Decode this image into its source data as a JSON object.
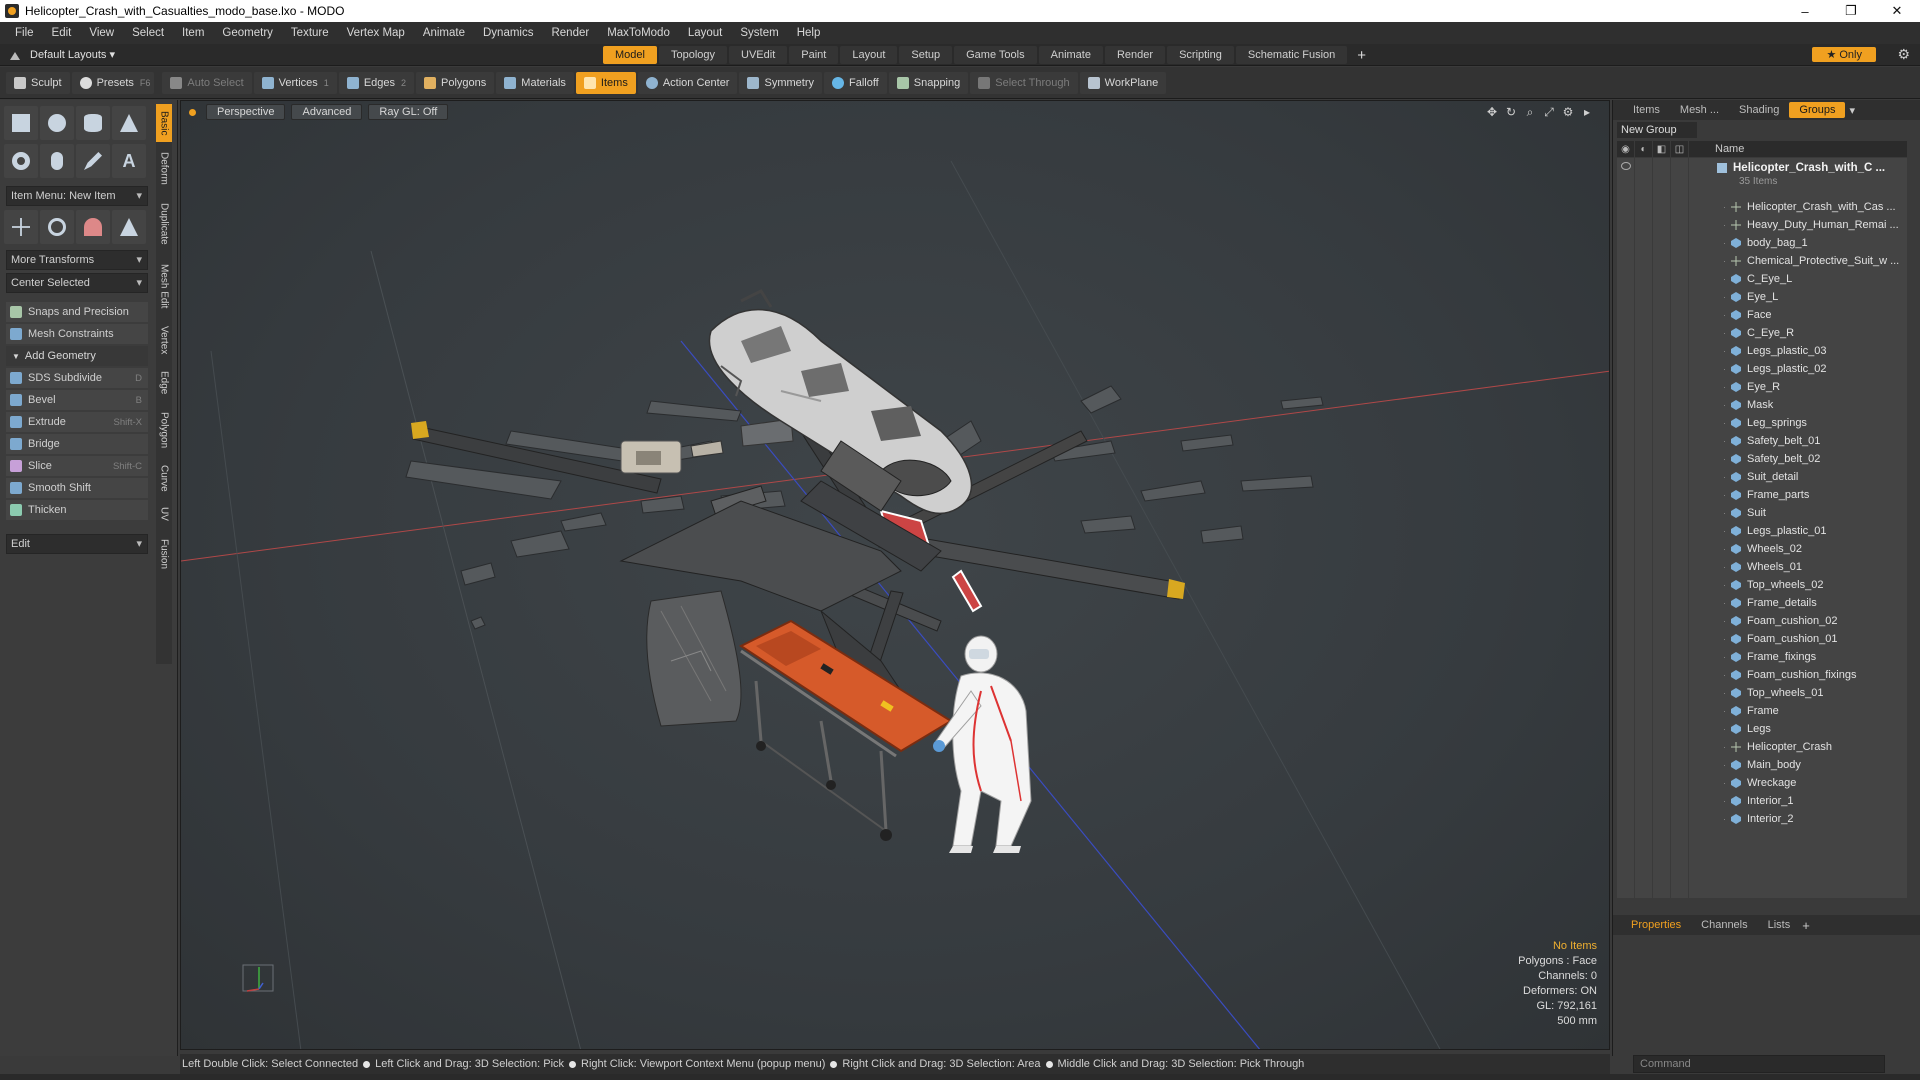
{
  "window": {
    "title": "Helicopter_Crash_with_Casualties_modo_base.lxo - MODO",
    "controls": [
      "–",
      "❐",
      "✕"
    ]
  },
  "menu": [
    "File",
    "Edit",
    "View",
    "Select",
    "Item",
    "Geometry",
    "Texture",
    "Vertex Map",
    "Animate",
    "Dynamics",
    "Render",
    "MaxToModo",
    "Layout",
    "System",
    "Help"
  ],
  "layoutbar": {
    "layout_dropdown": "Default Layouts ▾",
    "tabs": [
      "Model",
      "Topology",
      "UVEdit",
      "Paint",
      "Layout",
      "Setup",
      "Game Tools",
      "Animate",
      "Render",
      "Scripting",
      "Schematic Fusion"
    ],
    "active_tab": "Model",
    "add": "+",
    "only": "★ Only"
  },
  "toolbar": {
    "sculpt": "Sculpt",
    "presets": "Presets",
    "presets_key": "F6",
    "auto_select": "Auto Select",
    "vertices": "Vertices",
    "vertices_key": "1",
    "edges": "Edges",
    "edges_key": "2",
    "polygons": "Polygons",
    "materials": "Materials",
    "items": "Items",
    "action_center": "Action Center",
    "symmetry": "Symmetry",
    "falloff": "Falloff",
    "snapping": "Snapping",
    "select_through": "Select Through",
    "workplane": "WorkPlane"
  },
  "leftpanel": {
    "item_menu": "Item Menu: New Item",
    "more_transforms": "More Transforms",
    "center_selected": "Center Selected",
    "snaps": "Snaps and Precision",
    "mesh_constraints": "Mesh Constraints",
    "add_geometry": "Add Geometry",
    "tools": [
      {
        "label": "SDS Subdivide",
        "key": "D"
      },
      {
        "label": "Bevel",
        "key": "B"
      },
      {
        "label": "Extrude",
        "key": "Shift-X"
      },
      {
        "label": "Bridge",
        "key": ""
      },
      {
        "label": "Slice",
        "key": "Shift-C"
      },
      {
        "label": "Smooth Shift",
        "key": ""
      },
      {
        "label": "Thicken",
        "key": ""
      }
    ],
    "edit_dropdown": "Edit",
    "vtabs": [
      "Basic",
      "Deform",
      "Duplicate",
      "Mesh Edit",
      "Vertex",
      "Edge",
      "Polygon",
      "Curve",
      "UV",
      "Fusion"
    ]
  },
  "viewport": {
    "view": "Perspective",
    "shading": "Advanced",
    "raygl": "Ray GL: Off",
    "icons": [
      "✥",
      "↻",
      "⌕",
      "⤢",
      "⚙",
      "▸"
    ],
    "stats": {
      "selection": "No Items",
      "polygons": "Polygons : Face",
      "channels": "Channels: 0",
      "deformers": "Deformers: ON",
      "gl": "GL: 792,161",
      "scale": "500 mm"
    }
  },
  "rightpanel": {
    "tabs": [
      "Items",
      "Mesh ...",
      "Shading",
      "Groups"
    ],
    "active_tab": "Groups",
    "new_group": "New Group",
    "name_col": "Name",
    "group_name": "Helicopter_Crash_with_C ...",
    "group_count": "35 Items",
    "items": [
      {
        "name": "Helicopter_Crash_with_Cas ...",
        "type": "locator"
      },
      {
        "name": "Heavy_Duty_Human_Remai ...",
        "type": "locator"
      },
      {
        "name": "body_bag_1",
        "type": "mesh"
      },
      {
        "name": "Chemical_Protective_Suit_w ...",
        "type": "locator"
      },
      {
        "name": "C_Eye_L",
        "type": "mesh"
      },
      {
        "name": "Eye_L",
        "type": "mesh"
      },
      {
        "name": "Face",
        "type": "mesh"
      },
      {
        "name": "C_Eye_R",
        "type": "mesh"
      },
      {
        "name": "Legs_plastic_03",
        "type": "mesh"
      },
      {
        "name": "Legs_plastic_02",
        "type": "mesh"
      },
      {
        "name": "Eye_R",
        "type": "mesh"
      },
      {
        "name": "Mask",
        "type": "mesh"
      },
      {
        "name": "Leg_springs",
        "type": "mesh"
      },
      {
        "name": "Safety_belt_01",
        "type": "mesh"
      },
      {
        "name": "Safety_belt_02",
        "type": "mesh"
      },
      {
        "name": "Suit_detail",
        "type": "mesh"
      },
      {
        "name": "Frame_parts",
        "type": "mesh"
      },
      {
        "name": "Suit",
        "type": "mesh"
      },
      {
        "name": "Legs_plastic_01",
        "type": "mesh"
      },
      {
        "name": "Wheels_02",
        "type": "mesh"
      },
      {
        "name": "Wheels_01",
        "type": "mesh"
      },
      {
        "name": "Top_wheels_02",
        "type": "mesh"
      },
      {
        "name": "Frame_details",
        "type": "mesh"
      },
      {
        "name": "Foam_cushion_02",
        "type": "mesh"
      },
      {
        "name": "Foam_cushion_01",
        "type": "mesh"
      },
      {
        "name": "Frame_fixings",
        "type": "mesh"
      },
      {
        "name": "Foam_cushion_fixings",
        "type": "mesh"
      },
      {
        "name": "Top_wheels_01",
        "type": "mesh"
      },
      {
        "name": "Frame",
        "type": "mesh"
      },
      {
        "name": "Legs",
        "type": "mesh"
      },
      {
        "name": "Helicopter_Crash",
        "type": "locator"
      },
      {
        "name": "Main_body",
        "type": "mesh"
      },
      {
        "name": "Wreckage",
        "type": "mesh"
      },
      {
        "name": "Interior_1",
        "type": "mesh"
      },
      {
        "name": "Interior_2",
        "type": "mesh"
      }
    ],
    "bottom_tabs": [
      "Properties",
      "Channels",
      "Lists"
    ],
    "bottom_active": "Properties",
    "command_placeholder": "Command"
  },
  "statusbar": [
    "Left Double Click: Select Connected",
    "Left Click and Drag: 3D Selection: Pick",
    "Right Click: Viewport Context Menu (popup menu)",
    "Right Click and Drag: 3D Selection: Area",
    "Middle Click and Drag: 3D Selection: Pick Through"
  ],
  "colors": {
    "accent": "#f0a020",
    "background": "#3a3a3a",
    "viewport": "#3c4246",
    "grid_red": "#b04848",
    "grid_blue": "#3a4cc0"
  }
}
